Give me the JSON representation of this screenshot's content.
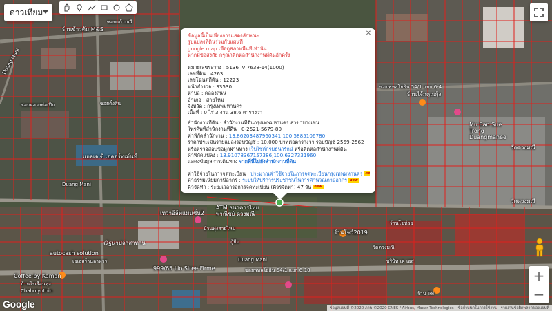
{
  "map_type": {
    "label": "ดาวเทียม"
  },
  "drawing_tools": [
    {
      "icon": "hand-icon"
    },
    {
      "icon": "marker-icon"
    },
    {
      "icon": "polyline-icon"
    },
    {
      "icon": "rectangle-icon"
    },
    {
      "icon": "circle-icon"
    },
    {
      "icon": "polygon-icon"
    }
  ],
  "info_window": {
    "notice": [
      "ข้อมูลนี้เป็นเพียงการแสดงลักษณะ",
      "รูปแปลงที่ดินร่วมกับแผนที่",
      "google map เพื่อดูสภาพพื้นที่เท่านั้น",
      "หากมีข้อสงสัย กรุณาติดต่อสำนักงานที่ดินอีกครั้ง"
    ],
    "fields": [
      "หมายเลขระวาง : 5136 IV 7638-14(1000)",
      "เลขที่ดิน : 4263",
      "เลขโฉนดที่ดิน : 12223",
      "หน้าสำรวจ : 33530",
      "ตำบล : คลองถนน",
      "อำเภอ : สายไหม",
      "จังหวัด : กรุงเทพมหานคร",
      "เนื้อที่ : 0 ไร่ 3 งาน 38.6 ตารางวา",
      "สำนักงานที่ดิน : สำนักงานที่ดินกรุงเทพมหานคร สาขาบางเขน",
      "โทรศัพท์สำนักงานที่ดิน : 0-2521-5679-80"
    ],
    "office_coord_label": "ค่าพิกัดสำนักงาน : ",
    "office_coord_value": "13.86203487960341,100.5885106780",
    "appraisal": "ราคาประเมินรายแปลงรอบบัญชี : 10,000 บาทต่อตารางวา รอบบัญชี 2559-2562",
    "inquiry_prefix": "หรือตรวจสอบข้อมูลผ่านทาง ",
    "inquiry_link": "เว็บไซต์กรมธนารักษ์",
    "inquiry_suffix": " หรือติดต่อสำนักงานที่ดิน",
    "land_coord_label": "ค่าพิกัดแปลง : ",
    "land_coord_value": "13.91078367157386,100.6327331960",
    "route_prefix": "แสดงข้อมูลการเดินทาง ",
    "route_link": "จากที่นี่ไปยังสำนักงานที่ดิน",
    "fee_rows": [
      {
        "label": "ค่าใช้จ่ายในการจดทะเบียน : ",
        "value": "ประมาณค่าใช้จ่ายในการจดทะเบียนกรุงเทพมหานคร"
      },
      {
        "label": "ค่าธรรมเนียมภาษีอากร : ",
        "value": "ระบบให้บริการประชาชนในการคำนวณภาษีอากร"
      },
      {
        "label": "คิวจัดทำ : ",
        "value": "ระยะเวลารอการจดทะเบียน (คิวรจัดทำ) 47 วัน"
      }
    ],
    "new_badge": "new"
  },
  "map_labels": [
    "ร้านข้าวต้ม M&S",
    "ซอยแก้วมณี",
    "Duang Mani",
    "ซอยหลวงพ่อเปีย",
    "ซอยตั้งสิน",
    "แอลเจ ซี เอคอร์ทเม้นท์",
    "Duang Mani",
    "ร้านไจ้กคุณกุ้ง",
    "Mu Ean Sue Trong Duangmanee",
    "วัดดวงมณี",
    "ATM ธนาคารไทย พาณิชย์ ดวงมณี",
    "เทวาอีลีทแมนชั่น2",
    "บ้านทุ่งสายไหม",
    "กู้ยืม",
    "ร้านโชห่วย",
    "ร้านโชว์2019",
    "ณัฐนาปล่าสาทาน",
    "autocash solution",
    "เอเอสร้านอาหาร",
    "999/65 Lio Siree Firme",
    "Coffee by Kaman",
    "บ้านไร่เรือนทุ่ง",
    "Chaholyothin",
    "Duang Mani",
    "ซอยพหลโยธิน 54/1 แยก 6-10",
    "วัดดวงมณี",
    "บริษัท เค เอส",
    "ซอยพหลโยธิน 54/1 แยก 6-4",
    "วัดดวงมณี",
    "ร้าน Tel"
  ],
  "attribution": {
    "map_data": "ข้อมูลแผนที่ ©2020 ภาพ ©2020 CNES / Airbus, Maxar Technologies",
    "terms": "ข้อกำหนดในการใช้งาน",
    "report": "รายงานข้อผิดพลาดของแผนที่"
  },
  "zoom": {
    "in": "+",
    "out": "−"
  },
  "logo": "Google"
}
